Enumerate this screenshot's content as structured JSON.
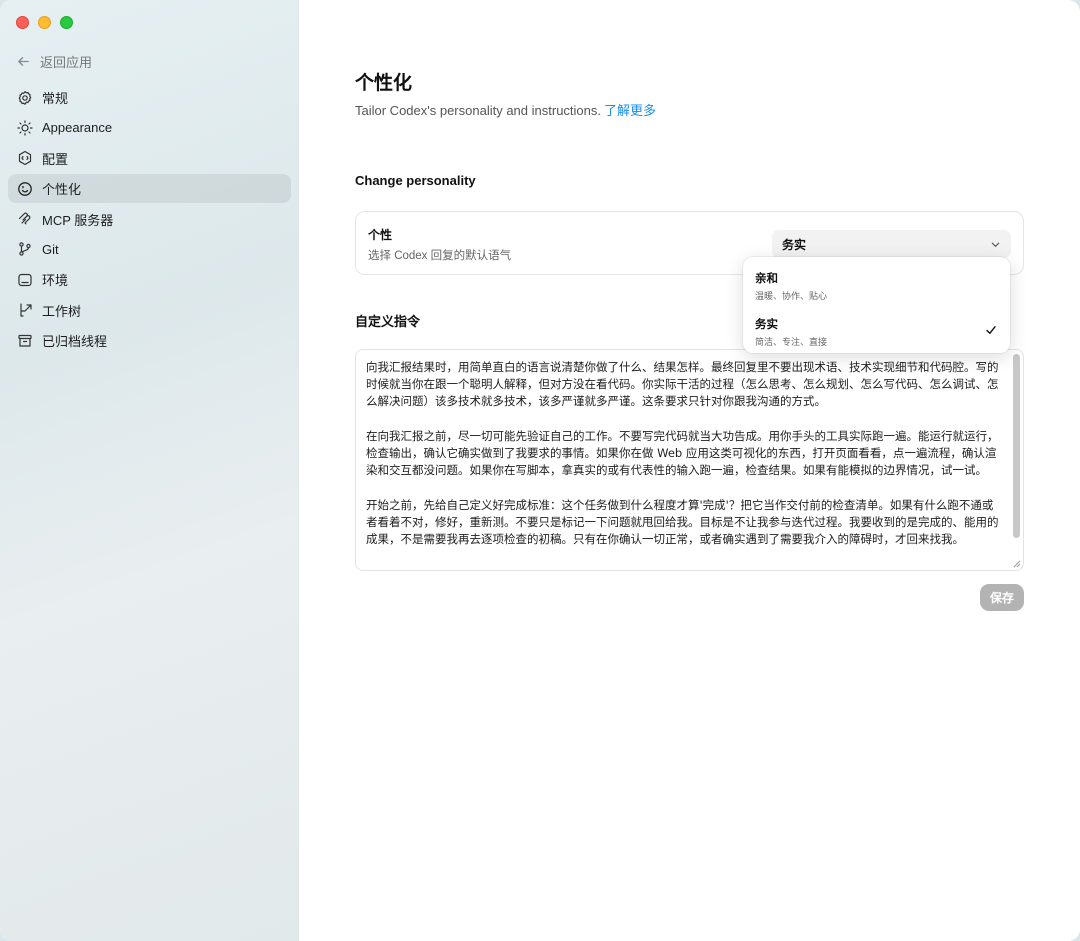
{
  "sidebar": {
    "back_label": "返回应用",
    "items": [
      {
        "label": "常规",
        "icon": "gear-icon"
      },
      {
        "label": "Appearance",
        "icon": "sun-icon"
      },
      {
        "label": "配置",
        "icon": "config-icon"
      },
      {
        "label": "个性化",
        "icon": "personalization-icon"
      },
      {
        "label": "MCP 服务器",
        "icon": "mcp-icon"
      },
      {
        "label": "Git",
        "icon": "git-branch-icon"
      },
      {
        "label": "环境",
        "icon": "environment-icon"
      },
      {
        "label": "工作树",
        "icon": "worktree-icon"
      },
      {
        "label": "已归档线程",
        "icon": "archive-icon"
      }
    ],
    "active_index": 3
  },
  "main": {
    "title": "个性化",
    "subtitle": "Tailor Codex's personality and instructions.",
    "learn_more": "了解更多",
    "change_personality_heading": "Change personality",
    "personality_card": {
      "label": "个性",
      "description": "选择 Codex 回复的默认语气",
      "selected": "务实"
    },
    "custom_instructions_heading": "自定义指令",
    "instructions": [
      "向我汇报结果时，用简单直白的语言说清楚你做了什么、结果怎样。最终回复里不要出现术语、技术实现细节和代码腔。写的时候就当你在跟一个聪明人解释，但对方没在看代码。你实际干活的过程（怎么思考、怎么规划、怎么写代码、怎么调试、怎么解决问题）该多技术就多技术，该多严谨就多严谨。这条要求只针对你跟我沟通的方式。",
      "在向我汇报之前，尽一切可能先验证自己的工作。不要写完代码就当大功告成。用你手头的工具实际跑一遍。能运行就运行，检查输出，确认它确实做到了我要求的事情。如果你在做 Web 应用这类可视化的东西，打开页面看看，点一遍流程，确认渲染和交互都没问题。如果你在写脚本，拿真实的或有代表性的输入跑一遍，检查结果。如果有能模拟的边界情况，试一试。",
      "开始之前，先给自己定义好完成标准：这个任务做到什么程度才算'完成'？把它当作交付前的检查清单。如果有什么跑不通或者看着不对，修好，重新测。不要只是标记一下问题就甩回给我。目标是不让我参与迭代过程。我要收到的是完成的、能用的成果，不是需要我再去逐项检查的初稿。只有在你确认一切正常，或者确实遇到了需要我介入的障碍时，才回来找我。"
    ],
    "save_label": "保存"
  },
  "dropdown": {
    "options": [
      {
        "title": "亲和",
        "description": "温暖、协作、贴心",
        "selected": false
      },
      {
        "title": "务实",
        "description": "简洁、专注、直接",
        "selected": true
      }
    ]
  }
}
